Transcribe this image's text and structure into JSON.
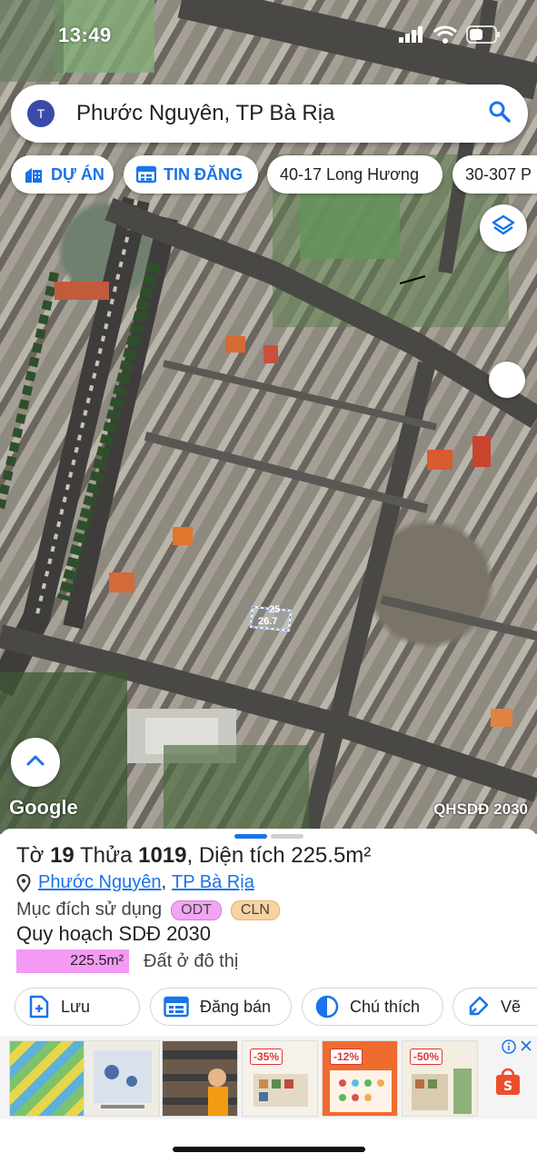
{
  "status_bar": {
    "time": "13:49"
  },
  "search": {
    "avatar_letter": "T",
    "query": "Phước Nguyên, TP Bà Rịa"
  },
  "chips": [
    {
      "label": "DỰ ÁN"
    },
    {
      "label": "TIN ĐĂNG"
    },
    {
      "label": "40-17 Long Hương"
    },
    {
      "label": "30-307 P"
    }
  ],
  "map": {
    "parcel_label_top": "25",
    "parcel_label_bottom": "26.7",
    "attribution": "Google",
    "layer_label": "QHSDĐ 2030"
  },
  "parcel": {
    "to_label": "Tờ",
    "to_value": "19",
    "thua_label": "Thửa",
    "thua_value": "1019",
    "area_label": "Diện tích",
    "area_value": "225.5m²",
    "ward": "Phước Nguyên",
    "city": "TP Bà Rịa",
    "purpose_label": "Mục đích sử dụng",
    "purpose_badges": [
      "ODT",
      "CLN"
    ],
    "plan_title": "Quy hoạch SDĐ 2030",
    "plan_area": "225.5m²",
    "plan_type": "Đất ở đô thị"
  },
  "actions": [
    {
      "label": "Lưu"
    },
    {
      "label": "Đăng bán"
    },
    {
      "label": "Chú thích"
    },
    {
      "label": "Vẽ"
    }
  ],
  "ad": {
    "discounts": [
      "-35%",
      "-12%",
      "-50%"
    ]
  },
  "colors": {
    "accent": "#1a73e8",
    "odt_badge": "#f2a6f2",
    "cln_badge": "#f7d3a2",
    "plan_bar": "#f49af4"
  }
}
